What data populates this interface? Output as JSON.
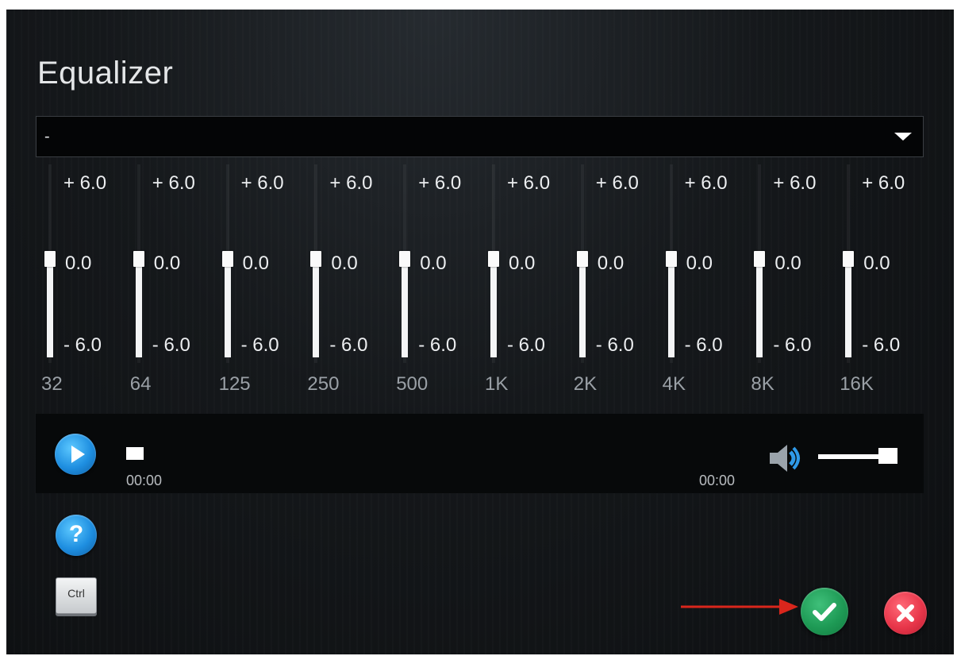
{
  "dialog": {
    "title": "Equalizer"
  },
  "preset": {
    "value": "-"
  },
  "bands": [
    {
      "freq": "32",
      "top": "+ 6.0",
      "value": "0.0",
      "bottom": "- 6.0",
      "level": 0.0
    },
    {
      "freq": "64",
      "top": "+ 6.0",
      "value": "0.0",
      "bottom": "- 6.0",
      "level": 0.0
    },
    {
      "freq": "125",
      "top": "+ 6.0",
      "value": "0.0",
      "bottom": "- 6.0",
      "level": 0.0
    },
    {
      "freq": "250",
      "top": "+ 6.0",
      "value": "0.0",
      "bottom": "- 6.0",
      "level": 0.0
    },
    {
      "freq": "500",
      "top": "+ 6.0",
      "value": "0.0",
      "bottom": "- 6.0",
      "level": 0.0
    },
    {
      "freq": "1K",
      "top": "+ 6.0",
      "value": "0.0",
      "bottom": "- 6.0",
      "level": 0.0
    },
    {
      "freq": "2K",
      "top": "+ 6.0",
      "value": "0.0",
      "bottom": "- 6.0",
      "level": 0.0
    },
    {
      "freq": "4K",
      "top": "+ 6.0",
      "value": "0.0",
      "bottom": "- 6.0",
      "level": 0.0
    },
    {
      "freq": "8K",
      "top": "+ 6.0",
      "value": "0.0",
      "bottom": "- 6.0",
      "level": 0.0
    },
    {
      "freq": "16K",
      "top": "+ 6.0",
      "value": "0.0",
      "bottom": "- 6.0",
      "level": 0.0
    }
  ],
  "player": {
    "current_time": "00:00",
    "total_time": "00:00",
    "progress": 0.0,
    "volume": 1.0,
    "play_icon": "play-icon",
    "volume_icon": "speaker-icon"
  },
  "help": {
    "label": "?",
    "icon": "help-icon"
  },
  "ctrl_key": {
    "label": "Ctrl"
  },
  "actions": {
    "ok_icon": "checkmark-icon",
    "cancel_icon": "close-icon",
    "colors": {
      "ok": "#1e9a55",
      "cancel": "#e8364a",
      "arrow": "#d9261c",
      "accent": "#1e8ee0"
    }
  }
}
